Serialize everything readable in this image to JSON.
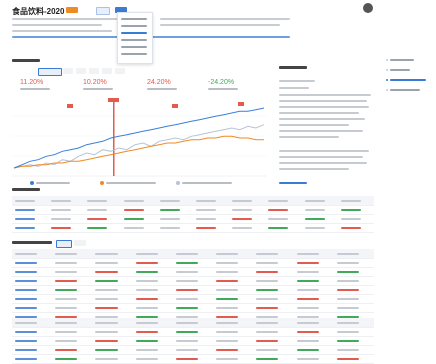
{
  "header": {
    "fund_title": "食品饮料-2020"
  },
  "colors": {
    "accent_blue": "#3a7bd5",
    "series_blue": "#3b7fd9",
    "series_orange": "#f08a24",
    "series_gray": "#b7c4d6",
    "red": "#e35a4f",
    "green": "#42a95b"
  },
  "stats": {
    "return": "11.20%",
    "benchmark": "10.20%",
    "relative": "24.20%",
    "drawdown": "-24.20%"
  },
  "chart_data": {
    "type": "line",
    "series": [
      {
        "values": [
          0,
          1,
          2,
          1,
          3,
          2,
          5,
          4,
          7,
          9,
          8,
          11,
          10,
          12,
          11,
          14,
          15,
          13,
          16,
          17,
          18,
          17,
          19,
          20,
          21,
          22,
          23,
          24,
          23,
          25,
          24,
          26
        ]
      },
      {
        "values": [
          0,
          1,
          1,
          2,
          2,
          3,
          3,
          4,
          4,
          5,
          6,
          7,
          8,
          9,
          10,
          11,
          12,
          13,
          14,
          15,
          15,
          16,
          17,
          17,
          18,
          18,
          19,
          19,
          18,
          18,
          17,
          17
        ]
      },
      {
        "values": [
          0,
          2,
          4,
          5,
          7,
          8,
          10,
          11,
          12,
          14,
          15,
          16,
          18,
          19,
          20,
          21,
          22,
          23,
          24,
          25,
          26,
          27,
          28,
          29,
          30,
          31,
          32,
          33,
          34,
          34,
          35,
          36
        ]
      }
    ]
  },
  "tables": {
    "returns": {
      "rows": 4,
      "cols": 10
    },
    "holdings": {
      "rows": 8
    },
    "trades": {
      "rows": 5
    }
  }
}
